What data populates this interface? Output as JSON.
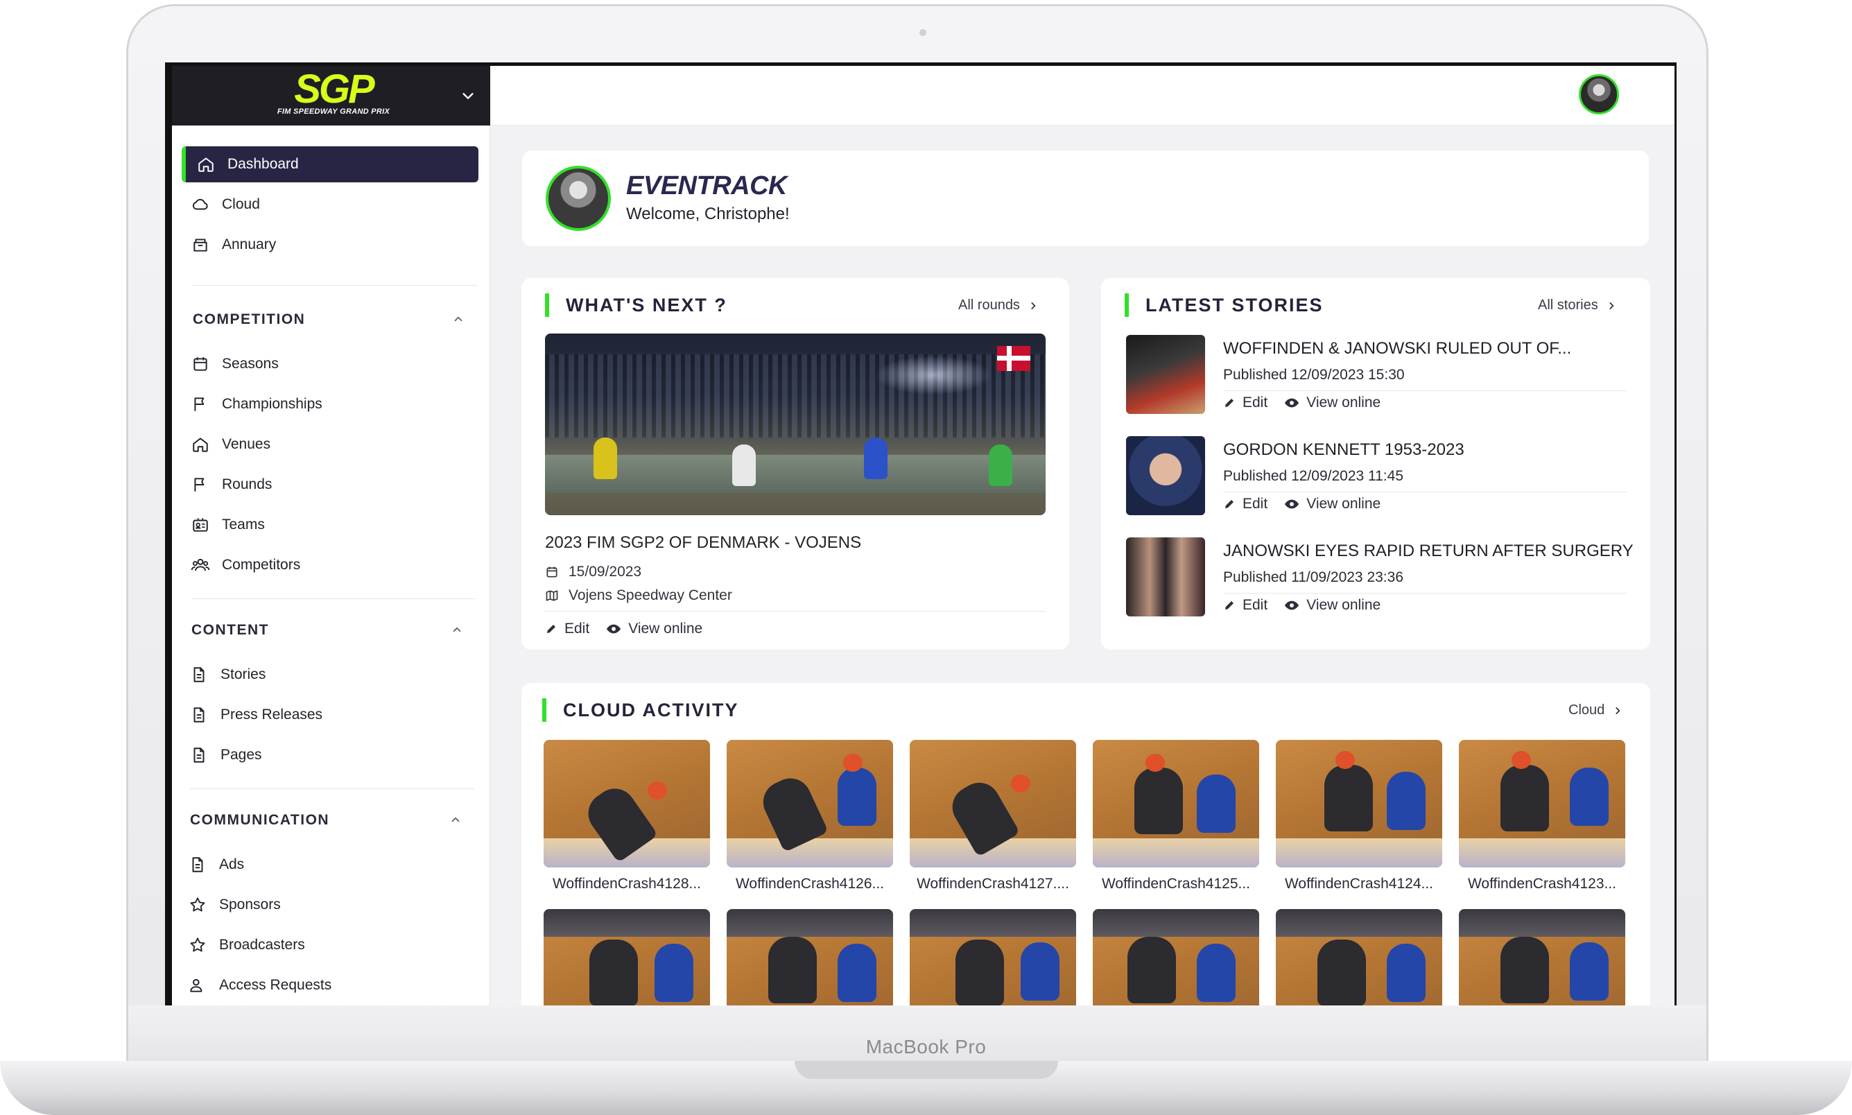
{
  "device": {
    "label": "MacBook Pro"
  },
  "brand": {
    "logo_text": "SGP",
    "logo_subtitle": "FIM SPEEDWAY GRAND PRIX"
  },
  "sidebar": {
    "top_items": [
      {
        "label": "Dashboard",
        "icon": "home-icon",
        "active": true
      },
      {
        "label": "Cloud",
        "icon": "cloud-icon"
      },
      {
        "label": "Annuary",
        "icon": "archive-icon"
      }
    ],
    "sections": [
      {
        "title": "COMPETITION",
        "items": [
          {
            "label": "Seasons",
            "icon": "calendar-icon"
          },
          {
            "label": "Championships",
            "icon": "flag-icon"
          },
          {
            "label": "Venues",
            "icon": "home-icon"
          },
          {
            "label": "Rounds",
            "icon": "flag-icon"
          },
          {
            "label": "Teams",
            "icon": "id-card-icon"
          },
          {
            "label": "Competitors",
            "icon": "users-icon"
          }
        ]
      },
      {
        "title": "CONTENT",
        "items": [
          {
            "label": "Stories",
            "icon": "document-icon"
          },
          {
            "label": "Press Releases",
            "icon": "document-icon"
          },
          {
            "label": "Pages",
            "icon": "document-icon"
          }
        ]
      },
      {
        "title": "COMMUNICATION",
        "items": [
          {
            "label": "Ads",
            "icon": "document-icon"
          },
          {
            "label": "Sponsors",
            "icon": "star-icon"
          },
          {
            "label": "Broadcasters",
            "icon": "star-icon"
          },
          {
            "label": "Access Requests",
            "icon": "user-check-icon"
          }
        ]
      }
    ]
  },
  "welcome": {
    "app_name": "EVENTRACK",
    "greeting": "Welcome, Christophe!"
  },
  "whats_next": {
    "title": "WHAT'S NEXT ?",
    "link": "All rounds",
    "event": {
      "title": "2023 FIM SGP2 OF DENMARK - VOJENS",
      "date": "15/09/2023",
      "venue": "Vojens Speedway Center",
      "country_flag": "denmark-flag"
    },
    "edit_label": "Edit",
    "view_label": "View online"
  },
  "latest_stories": {
    "title": "LATEST STORIES",
    "link": "All stories",
    "edit_label": "Edit",
    "view_label": "View online",
    "items": [
      {
        "title": "WOFFINDEN & JANOWSKI RULED OUT OF...",
        "published": "Published 12/09/2023 15:30"
      },
      {
        "title": "GORDON KENNETT 1953-2023",
        "published": "Published 12/09/2023 11:45"
      },
      {
        "title": "JANOWSKI EYES RAPID RETURN AFTER SURGERY",
        "published": "Published 11/09/2023 23:36"
      }
    ]
  },
  "cloud_activity": {
    "title": "CLOUD ACTIVITY",
    "link": "Cloud",
    "files": [
      "WoffindenCrash4128...",
      "WoffindenCrash4126...",
      "WoffindenCrash4127....",
      "WoffindenCrash4125...",
      "WoffindenCrash4124...",
      "WoffindenCrash4123..."
    ]
  },
  "colors": {
    "accent": "#33e02a",
    "active_nav": "#282544",
    "logo": "#d7ff1a",
    "header_dark": "#1e1e24"
  }
}
